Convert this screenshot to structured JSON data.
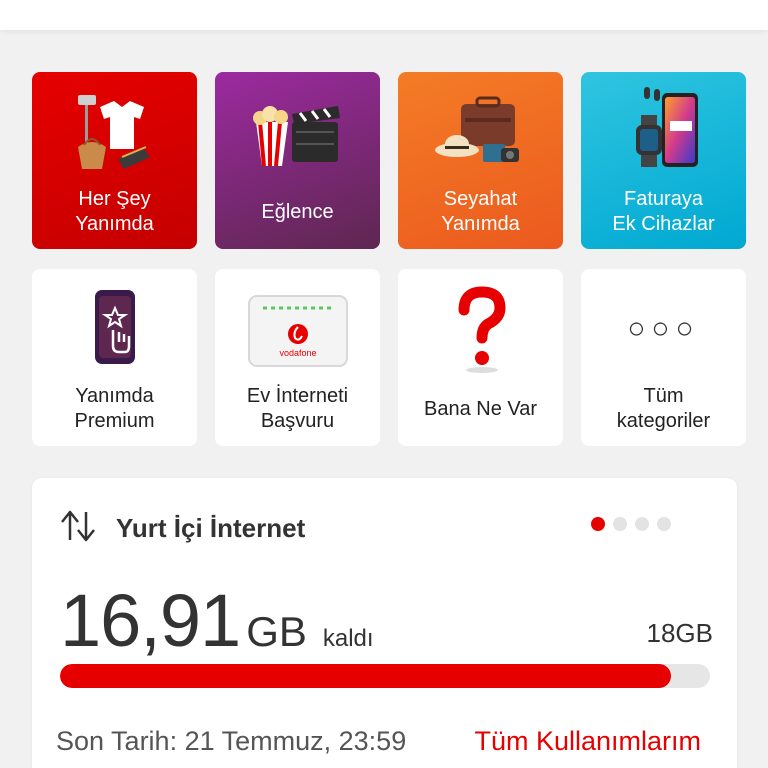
{
  "colors": {
    "brand_red": "#e60000",
    "tile_red": "#d70000",
    "tile_purple": "#7b2889",
    "tile_orange": "#f06a22",
    "tile_cyan": "#17b6db"
  },
  "categories": [
    {
      "label": "Her Şey\nYanımda",
      "icon": "clothes-icon"
    },
    {
      "label": "Eğlence",
      "icon": "popcorn-clapper-icon"
    },
    {
      "label": "Seyahat\nYanımda",
      "icon": "luggage-icon"
    },
    {
      "label": "Faturaya\nEk Cihazlar",
      "icon": "devices-icon"
    },
    {
      "label": "Yanımda\nPremium",
      "icon": "premium-phone-icon"
    },
    {
      "label": "Ev İnterneti\nBaşvuru",
      "icon": "modem-icon",
      "art_text": "vodafone"
    },
    {
      "label": "Bana Ne Var",
      "icon": "question-mark-icon"
    },
    {
      "label": "Tüm\nkategoriler",
      "icon": "more-dots-icon",
      "art_text": "○○○"
    }
  ],
  "usage_card": {
    "title": "Yurt İçi İnternet",
    "icon": "data-transfer-icon",
    "remaining_value": "16,91",
    "remaining_unit": "GB",
    "remaining_label": "kaldı",
    "total": "18GB",
    "remaining_fraction": 0.94,
    "due_text": "Son Tarih: 21 Temmuz, 23:59",
    "link_label": "Tüm Kullanımlarım",
    "pager_count": 4,
    "pager_active": 0
  }
}
